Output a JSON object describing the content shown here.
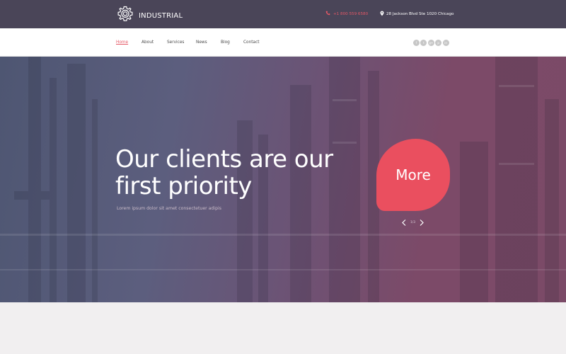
{
  "header": {
    "brand": "INDUSTRIAL",
    "phone": "+1 800 559 6580",
    "address": "28 Jackson Blvd Ste 1020 Chicago"
  },
  "nav": {
    "items": [
      {
        "label": "Home",
        "active": true
      },
      {
        "label": "About",
        "active": false
      },
      {
        "label": "Services",
        "active": false
      },
      {
        "label": "News",
        "active": false
      },
      {
        "label": "Blog",
        "active": false
      },
      {
        "label": "Contact",
        "active": false
      }
    ],
    "social": [
      "f",
      "t",
      "g+",
      "p",
      "in"
    ]
  },
  "hero": {
    "title_line1": "Our clients are our",
    "title_line2": "first priority",
    "subtitle": "Lorem ipsum dolor sit amet consectetuer adipis",
    "button_label": "More",
    "pager": "1/3"
  },
  "colors": {
    "accent": "#ea4f5f",
    "topbar": "#4a4558"
  }
}
